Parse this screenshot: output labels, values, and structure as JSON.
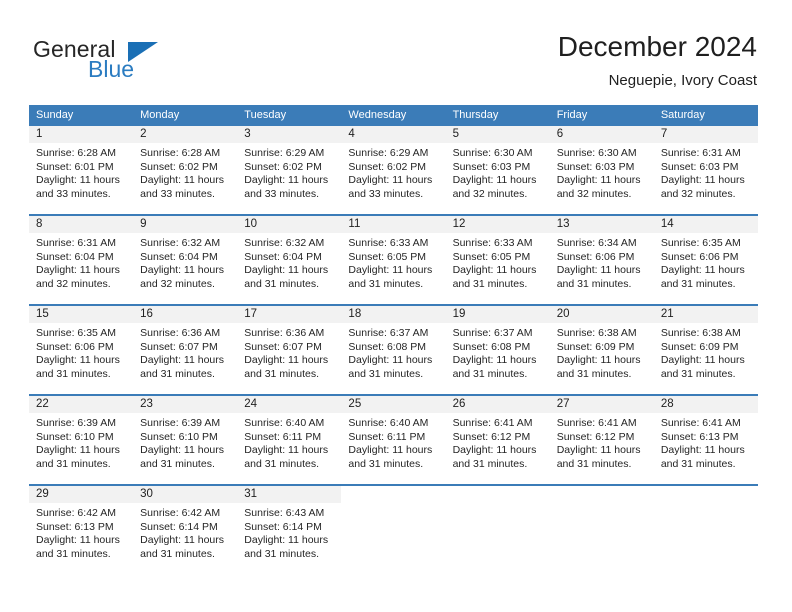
{
  "brand": {
    "name_part1": "General",
    "name_part2": "Blue",
    "logo_icon": "blue-triangle-icon",
    "colors": {
      "general_text": "#262626",
      "blue_text": "#2b7cc1",
      "triangle": "#1a6fb5"
    }
  },
  "header": {
    "title": "December 2024",
    "subtitle": "Neguepie, Ivory Coast"
  },
  "theme": {
    "header_blue": "#3b7cb8",
    "daynum_band": "#f2f2f2",
    "row_separator": "#3b7cb8",
    "text": "#252525"
  },
  "calendar": {
    "weekday_headers": [
      "Sunday",
      "Monday",
      "Tuesday",
      "Wednesday",
      "Thursday",
      "Friday",
      "Saturday"
    ],
    "weeks": [
      [
        {
          "day": "1",
          "sunrise": "Sunrise: 6:28 AM",
          "sunset": "Sunset: 6:01 PM",
          "daylight": "Daylight: 11 hours and 33 minutes."
        },
        {
          "day": "2",
          "sunrise": "Sunrise: 6:28 AM",
          "sunset": "Sunset: 6:02 PM",
          "daylight": "Daylight: 11 hours and 33 minutes."
        },
        {
          "day": "3",
          "sunrise": "Sunrise: 6:29 AM",
          "sunset": "Sunset: 6:02 PM",
          "daylight": "Daylight: 11 hours and 33 minutes."
        },
        {
          "day": "4",
          "sunrise": "Sunrise: 6:29 AM",
          "sunset": "Sunset: 6:02 PM",
          "daylight": "Daylight: 11 hours and 33 minutes."
        },
        {
          "day": "5",
          "sunrise": "Sunrise: 6:30 AM",
          "sunset": "Sunset: 6:03 PM",
          "daylight": "Daylight: 11 hours and 32 minutes."
        },
        {
          "day": "6",
          "sunrise": "Sunrise: 6:30 AM",
          "sunset": "Sunset: 6:03 PM",
          "daylight": "Daylight: 11 hours and 32 minutes."
        },
        {
          "day": "7",
          "sunrise": "Sunrise: 6:31 AM",
          "sunset": "Sunset: 6:03 PM",
          "daylight": "Daylight: 11 hours and 32 minutes."
        }
      ],
      [
        {
          "day": "8",
          "sunrise": "Sunrise: 6:31 AM",
          "sunset": "Sunset: 6:04 PM",
          "daylight": "Daylight: 11 hours and 32 minutes."
        },
        {
          "day": "9",
          "sunrise": "Sunrise: 6:32 AM",
          "sunset": "Sunset: 6:04 PM",
          "daylight": "Daylight: 11 hours and 32 minutes."
        },
        {
          "day": "10",
          "sunrise": "Sunrise: 6:32 AM",
          "sunset": "Sunset: 6:04 PM",
          "daylight": "Daylight: 11 hours and 31 minutes."
        },
        {
          "day": "11",
          "sunrise": "Sunrise: 6:33 AM",
          "sunset": "Sunset: 6:05 PM",
          "daylight": "Daylight: 11 hours and 31 minutes."
        },
        {
          "day": "12",
          "sunrise": "Sunrise: 6:33 AM",
          "sunset": "Sunset: 6:05 PM",
          "daylight": "Daylight: 11 hours and 31 minutes."
        },
        {
          "day": "13",
          "sunrise": "Sunrise: 6:34 AM",
          "sunset": "Sunset: 6:06 PM",
          "daylight": "Daylight: 11 hours and 31 minutes."
        },
        {
          "day": "14",
          "sunrise": "Sunrise: 6:35 AM",
          "sunset": "Sunset: 6:06 PM",
          "daylight": "Daylight: 11 hours and 31 minutes."
        }
      ],
      [
        {
          "day": "15",
          "sunrise": "Sunrise: 6:35 AM",
          "sunset": "Sunset: 6:06 PM",
          "daylight": "Daylight: 11 hours and 31 minutes."
        },
        {
          "day": "16",
          "sunrise": "Sunrise: 6:36 AM",
          "sunset": "Sunset: 6:07 PM",
          "daylight": "Daylight: 11 hours and 31 minutes."
        },
        {
          "day": "17",
          "sunrise": "Sunrise: 6:36 AM",
          "sunset": "Sunset: 6:07 PM",
          "daylight": "Daylight: 11 hours and 31 minutes."
        },
        {
          "day": "18",
          "sunrise": "Sunrise: 6:37 AM",
          "sunset": "Sunset: 6:08 PM",
          "daylight": "Daylight: 11 hours and 31 minutes."
        },
        {
          "day": "19",
          "sunrise": "Sunrise: 6:37 AM",
          "sunset": "Sunset: 6:08 PM",
          "daylight": "Daylight: 11 hours and 31 minutes."
        },
        {
          "day": "20",
          "sunrise": "Sunrise: 6:38 AM",
          "sunset": "Sunset: 6:09 PM",
          "daylight": "Daylight: 11 hours and 31 minutes."
        },
        {
          "day": "21",
          "sunrise": "Sunrise: 6:38 AM",
          "sunset": "Sunset: 6:09 PM",
          "daylight": "Daylight: 11 hours and 31 minutes."
        }
      ],
      [
        {
          "day": "22",
          "sunrise": "Sunrise: 6:39 AM",
          "sunset": "Sunset: 6:10 PM",
          "daylight": "Daylight: 11 hours and 31 minutes."
        },
        {
          "day": "23",
          "sunrise": "Sunrise: 6:39 AM",
          "sunset": "Sunset: 6:10 PM",
          "daylight": "Daylight: 11 hours and 31 minutes."
        },
        {
          "day": "24",
          "sunrise": "Sunrise: 6:40 AM",
          "sunset": "Sunset: 6:11 PM",
          "daylight": "Daylight: 11 hours and 31 minutes."
        },
        {
          "day": "25",
          "sunrise": "Sunrise: 6:40 AM",
          "sunset": "Sunset: 6:11 PM",
          "daylight": "Daylight: 11 hours and 31 minutes."
        },
        {
          "day": "26",
          "sunrise": "Sunrise: 6:41 AM",
          "sunset": "Sunset: 6:12 PM",
          "daylight": "Daylight: 11 hours and 31 minutes."
        },
        {
          "day": "27",
          "sunrise": "Sunrise: 6:41 AM",
          "sunset": "Sunset: 6:12 PM",
          "daylight": "Daylight: 11 hours and 31 minutes."
        },
        {
          "day": "28",
          "sunrise": "Sunrise: 6:41 AM",
          "sunset": "Sunset: 6:13 PM",
          "daylight": "Daylight: 11 hours and 31 minutes."
        }
      ],
      [
        {
          "day": "29",
          "sunrise": "Sunrise: 6:42 AM",
          "sunset": "Sunset: 6:13 PM",
          "daylight": "Daylight: 11 hours and 31 minutes."
        },
        {
          "day": "30",
          "sunrise": "Sunrise: 6:42 AM",
          "sunset": "Sunset: 6:14 PM",
          "daylight": "Daylight: 11 hours and 31 minutes."
        },
        {
          "day": "31",
          "sunrise": "Sunrise: 6:43 AM",
          "sunset": "Sunset: 6:14 PM",
          "daylight": "Daylight: 11 hours and 31 minutes."
        },
        {
          "day": "",
          "sunrise": "",
          "sunset": "",
          "daylight": ""
        },
        {
          "day": "",
          "sunrise": "",
          "sunset": "",
          "daylight": ""
        },
        {
          "day": "",
          "sunrise": "",
          "sunset": "",
          "daylight": ""
        },
        {
          "day": "",
          "sunrise": "",
          "sunset": "",
          "daylight": ""
        }
      ]
    ]
  }
}
